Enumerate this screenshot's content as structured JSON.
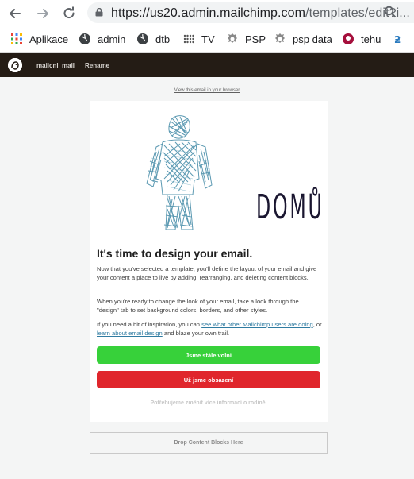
{
  "browser": {
    "url_main": "https://us20.admin.mailchimp.com",
    "url_rest": "/templates/edit?i...",
    "bookmarks": [
      {
        "label": "Aplikace",
        "icon": "apps-grid-icon"
      },
      {
        "label": "admin",
        "icon": "globe-icon"
      },
      {
        "label": "dtb",
        "icon": "globe-icon"
      },
      {
        "label": "TV",
        "icon": "tv-icon"
      },
      {
        "label": "PSP",
        "icon": "emblem-icon"
      },
      {
        "label": "psp data",
        "icon": "emblem-icon"
      },
      {
        "label": "tehu",
        "icon": "red-circle-icon"
      },
      {
        "label": "",
        "icon": "translate-icon"
      }
    ]
  },
  "app_bar": {
    "campaign_name": "mailcnl_mail",
    "rename_label": "Rename"
  },
  "email": {
    "view_in_browser": "View this email in your browser",
    "brand_text": "DOMŮ",
    "heading": "It's time to design your email.",
    "paragraph1": "Now that you've selected a template, you'll define the layout of your email and give your content a place to live by adding, rearranging, and deleting content blocks.",
    "paragraph2": "When you're ready to change the look of your email, take a look through the \"design\" tab to set background colors, borders, and other styles.",
    "paragraph3_before": "If you need a bit of inspiration, you can ",
    "paragraph3_link1": "see what other Mailchimp users are doing",
    "paragraph3_middle": ", or ",
    "paragraph3_link2": "learn about email design",
    "paragraph3_after": " and blaze your own trail.",
    "button_free": "Jsme stále volní",
    "button_busy": "Už jsme obsazení",
    "footer_note": "Potřebujeme zmênit více informací o rodině."
  },
  "drop_zone": {
    "label": "Drop Content Blocks Here"
  },
  "colors": {
    "app_bar": "#241c15",
    "green_button": "#37d13a",
    "red_button": "#e0262c",
    "link": "#2f7ba1",
    "brand": "#1a1630",
    "sketch": "#4a8faa"
  }
}
